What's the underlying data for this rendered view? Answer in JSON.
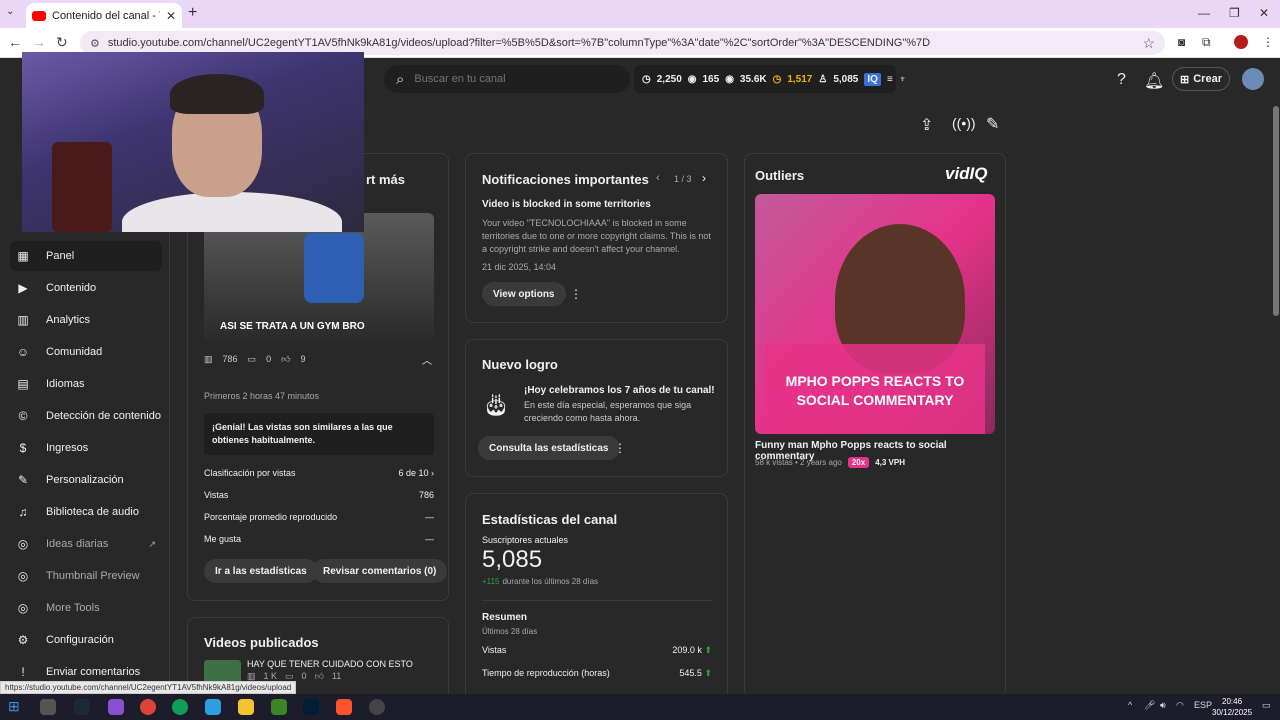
{
  "browser": {
    "tab_title": "Contenido del canal - YouTube",
    "new_tab": "+",
    "url": "studio.youtube.com/channel/UC2egentYT1AV5fhNk9kA81g/videos/upload?filter=%5B%5D&sort=%7B\"columnType\"%3A\"date\"%2C\"sortOrder\"%3A\"DESCENDING\"%7D",
    "status_url": "https://studio.youtube.com/channel/UC2egentYT1AV5fhNk9kA81g/videos/upload"
  },
  "header": {
    "search_placeholder": "Buscar en tu canal",
    "stats": [
      "2,250",
      "165",
      "35.6K",
      "1,517",
      "5,085"
    ],
    "create_label": "Crear"
  },
  "sidebar": {
    "items": [
      {
        "label": "Panel",
        "icon": "dashboard-icon"
      },
      {
        "label": "Contenido",
        "icon": "content-icon"
      },
      {
        "label": "Analytics",
        "icon": "analytics-icon"
      },
      {
        "label": "Comunidad",
        "icon": "community-icon"
      },
      {
        "label": "Idiomas",
        "icon": "subtitles-icon"
      },
      {
        "label": "Detección de contenido",
        "icon": "copyright-icon"
      },
      {
        "label": "Ingresos",
        "icon": "money-icon"
      },
      {
        "label": "Personalización",
        "icon": "wand-icon"
      },
      {
        "label": "Biblioteca de audio",
        "icon": "audio-library-icon"
      },
      {
        "label": "Ideas diarias",
        "icon": "vidiq-icon"
      },
      {
        "label": "Thumbnail Preview",
        "icon": "vidiq-icon"
      },
      {
        "label": "More Tools",
        "icon": "vidiq-icon"
      },
      {
        "label": "Configuración",
        "icon": "gear-icon"
      },
      {
        "label": "Enviar comentarios",
        "icon": "feedback-icon"
      }
    ]
  },
  "latest_video": {
    "title_partial": "rt más",
    "thumb_text": "ASI SE TRATA A UN GYM BRO",
    "views": "786",
    "comments": "0",
    "likes": "9",
    "period": "Primeros 2 horas 47 minutos",
    "message": "¡Genial! Las vistas son similares a las que obtienes habitualmente.",
    "rows": [
      {
        "label": "Clasificación por vistas",
        "value": "6 de 10"
      },
      {
        "label": "Vistas",
        "value": "786"
      },
      {
        "label": "Porcentaje promedio reproducido",
        "value": "—"
      },
      {
        "label": "Me gusta",
        "value": "—"
      }
    ],
    "btn_stats": "Ir a las estadísticas",
    "btn_comments": "Revisar comentarios (0)"
  },
  "published": {
    "title": "Videos publicados",
    "item_title": "HAY QUE TENER CUIDADO CON ESTO",
    "item_views": "1 K",
    "item_comments": "0",
    "item_likes": "11"
  },
  "notifications": {
    "title": "Notificaciones importantes",
    "pager": "1 / 3",
    "headline": "Video is blocked in some territories",
    "body": "Your video \"TECNOLOCHIAAA\" is blocked in some territories due to one or more copyright claims. This is not a copyright strike and doesn't affect your channel.",
    "date": "21 dic 2025, 14:04",
    "btn": "View options"
  },
  "achievement": {
    "title": "Nuevo logro",
    "headline": "¡Hoy celebramos los 7 años de tu canal!",
    "body": "En este día especial, esperamos que siga creciendo como hasta ahora.",
    "btn": "Consulta las estadísticas"
  },
  "channel_stats": {
    "title": "Estadísticas del canal",
    "subs_label": "Suscriptores actuales",
    "subs_value": "5,085",
    "delta": "+115",
    "delta_text": "durante los últimos 28 días",
    "summary_title": "Resumen",
    "summary_sub": "Últimos 28 días",
    "rows": [
      {
        "label": "Vistas",
        "value": "209.0 k"
      },
      {
        "label": "Tiempo de reproducción (horas)",
        "value": "545.5"
      }
    ]
  },
  "outliers": {
    "title": "Outliers",
    "brand": "vidIQ",
    "thumb_text": "MPHO POPPS REACTS TO SOCIAL COMMENTARY",
    "video_title": "Funny man Mpho Popps reacts to social commentary",
    "meta": "58 k vistas • 2 years ago",
    "multiplier": "20x",
    "vph": "4,3 VPH"
  },
  "taskbar": {
    "lang": "ESP",
    "time": "20:46",
    "date": "30/12/2025"
  },
  "colors": {
    "accent_red": "#ff0033",
    "success_green": "#2ba640",
    "gold": "#f4b400",
    "pink": "#e6338a"
  }
}
